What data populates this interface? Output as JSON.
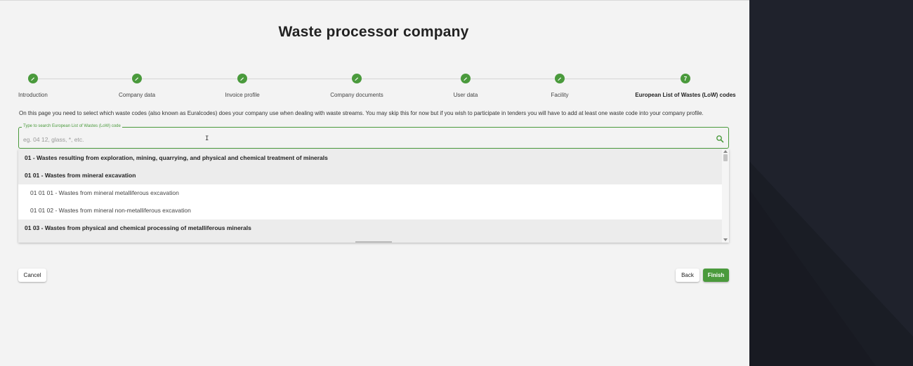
{
  "page": {
    "title": "Waste processor company",
    "intro": "On this page you need to select which waste codes (also known as Euralcodes) does your company use when dealing with waste streams. You may skip this for now but if you wish to participate in tenders you will have to add at least one waste code into your company profile."
  },
  "stepper": {
    "steps": [
      {
        "label": "Introduction",
        "state": "done",
        "icon": "check-icon"
      },
      {
        "label": "Company data",
        "state": "done",
        "icon": "check-icon"
      },
      {
        "label": "Invoice profile",
        "state": "done",
        "icon": "check-icon"
      },
      {
        "label": "Company documents",
        "state": "done",
        "icon": "check-icon"
      },
      {
        "label": "User data",
        "state": "done",
        "icon": "check-icon"
      },
      {
        "label": "Facility",
        "state": "done",
        "icon": "check-icon"
      },
      {
        "label": "European List of Wastes (LoW) codes",
        "state": "active",
        "number": "7"
      }
    ]
  },
  "search": {
    "label": "Type to search European List of Wastes (LoW) code",
    "placeholder": "eg. 04 12, glass, *, etc.",
    "value": "",
    "icon": "search-icon"
  },
  "dropdown": {
    "items": [
      {
        "type": "group",
        "text": "01 - Wastes resulting from exploration, mining, quarrying, and physical and chemical treatment of minerals"
      },
      {
        "type": "group",
        "text": "01 01 - Wastes from mineral excavation"
      },
      {
        "type": "child",
        "text": "01 01 01 - Wastes from mineral metalliferous excavation"
      },
      {
        "type": "child",
        "text": "01 01 02 - Wastes from mineral non-metalliferous excavation"
      },
      {
        "type": "group",
        "text": "01 03 - Wastes from physical and chemical processing of metalliferous minerals"
      }
    ]
  },
  "actions": {
    "cancel": "Cancel",
    "back": "Back",
    "finish": "Finish"
  },
  "colors": {
    "accent": "#4a9a3c",
    "background": "#f3f3f3",
    "sidebar": "#1e212b"
  }
}
